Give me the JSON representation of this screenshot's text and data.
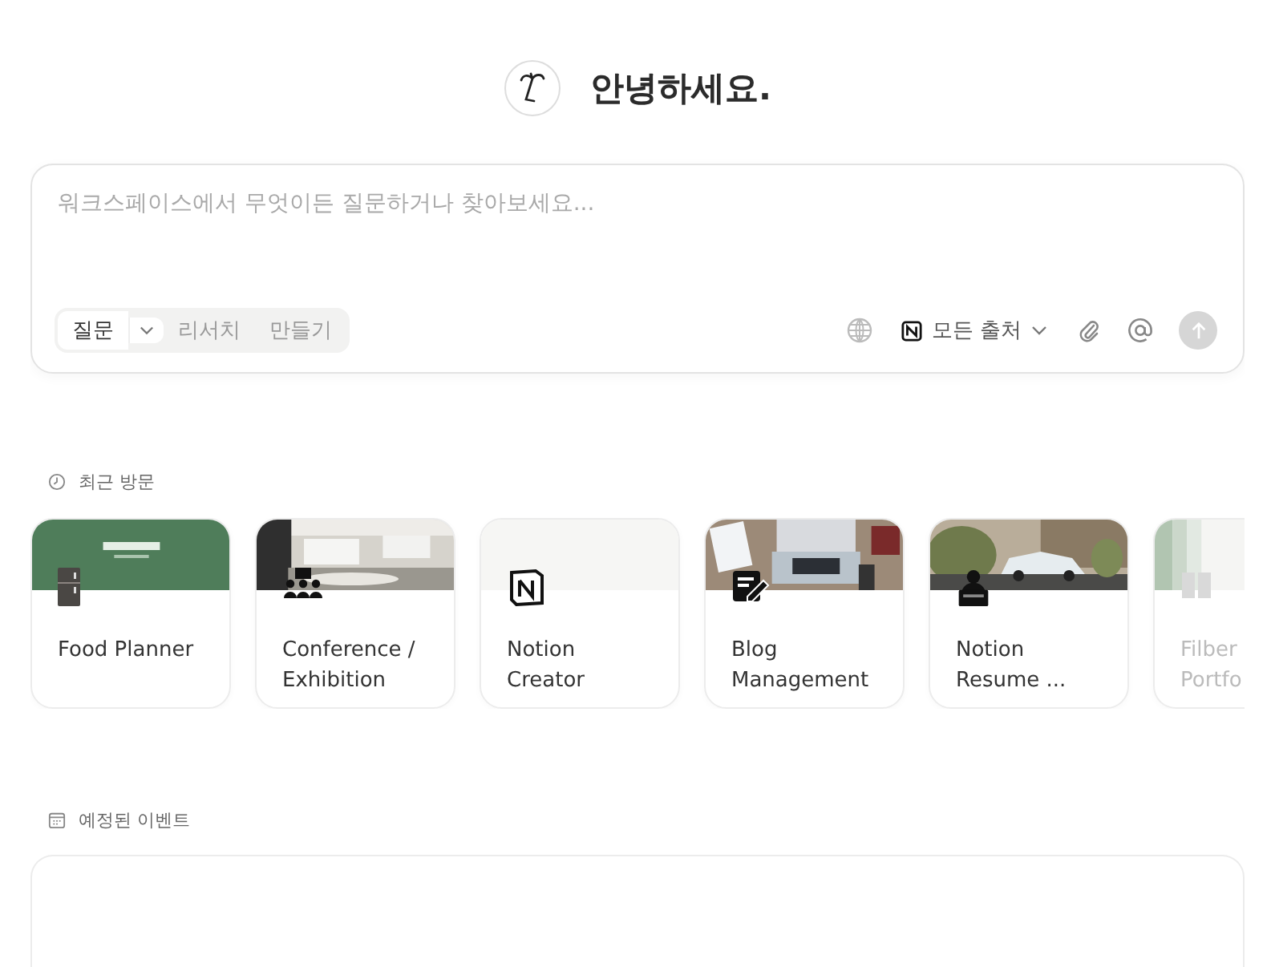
{
  "greeting": "안녕하세요.",
  "composer": {
    "placeholder": "워크스페이스에서 무엇이든 질문하거나 찾아보세요...",
    "modes": [
      {
        "label": "질문",
        "selected": true,
        "dropdown": true
      },
      {
        "label": "리서치",
        "selected": false,
        "dropdown": false
      },
      {
        "label": "만들기",
        "selected": false,
        "dropdown": false
      }
    ],
    "source": "모든 출처"
  },
  "recent": {
    "title": "최근 방문",
    "cards": [
      {
        "lines": [
          "Food Planner"
        ],
        "faded": false
      },
      {
        "lines": [
          "Conference /",
          "Exhibition"
        ],
        "faded": false
      },
      {
        "lines": [
          "Notion",
          "Creator"
        ],
        "faded": false
      },
      {
        "lines": [
          "Blog",
          "Management"
        ],
        "faded": false
      },
      {
        "lines": [
          "Notion",
          "Resume ..."
        ],
        "faded": false
      },
      {
        "lines": [
          "Filber",
          "Portfo"
        ],
        "faded": true
      }
    ]
  },
  "events": {
    "title": "예정된 이벤트"
  }
}
